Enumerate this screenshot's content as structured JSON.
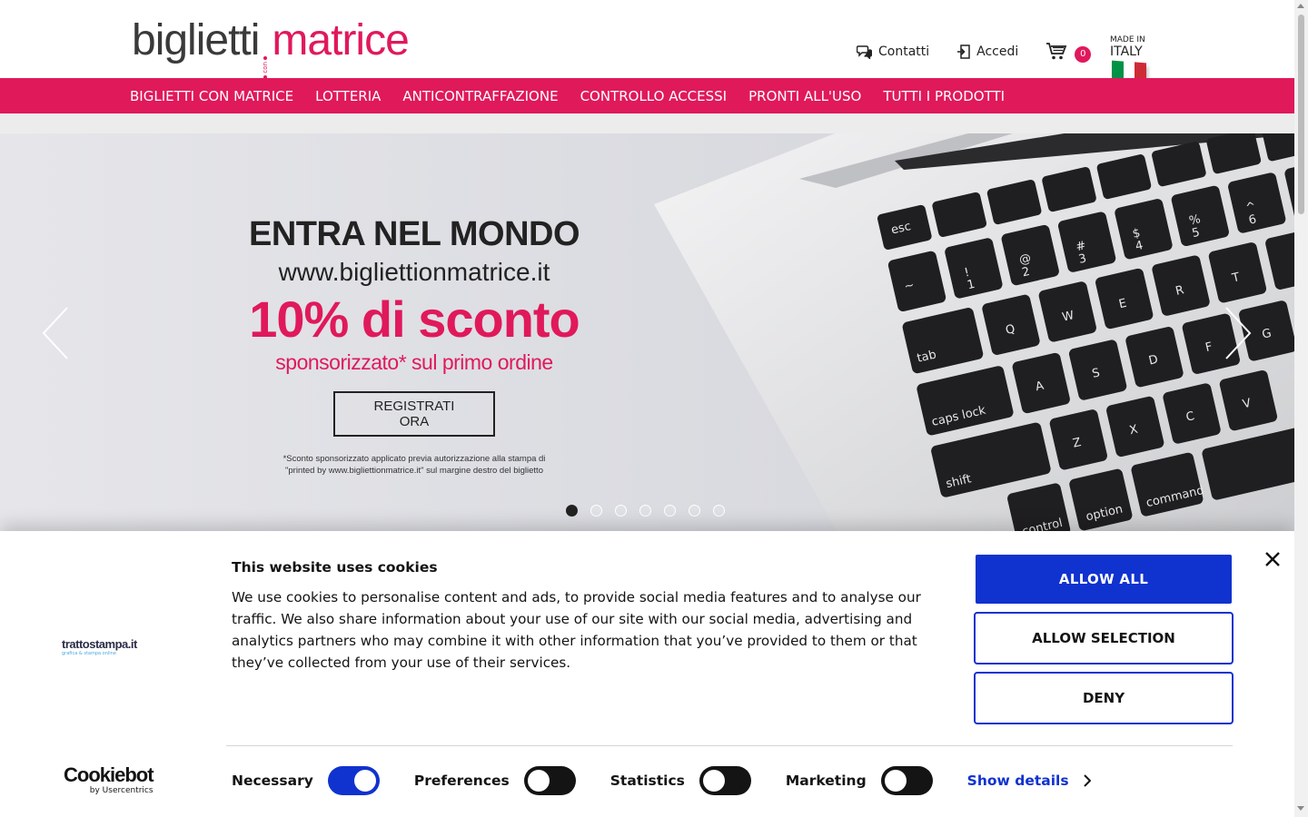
{
  "header": {
    "logo": {
      "part1": "biglietti",
      "connector": "con",
      "part2": "matrice"
    },
    "contacts_label": "Contatti",
    "login_label": "Accedi",
    "cart_count": "0",
    "made_in_line1": "MADE IN",
    "made_in_line2": "ITALY",
    "flag_colors": [
      "#009246",
      "#ffffff",
      "#ce2b37"
    ]
  },
  "nav": {
    "items": [
      {
        "label": "BIGLIETTI CON MATRICE"
      },
      {
        "label": "LOTTERIA"
      },
      {
        "label": "ANTICONTRAFFAZIONE"
      },
      {
        "label": "CONTROLLO ACCESSI"
      },
      {
        "label": "PRONTI ALL'USO"
      },
      {
        "label": "TUTTI I PRODOTTI"
      }
    ]
  },
  "hero": {
    "title": "ENTRA NEL MONDO",
    "url": "www.bigliettionmatrice.it",
    "discount": "10% di sconto",
    "subtitle": "sponsorizzato* sul primo ordine",
    "cta": "REGISTRATI ORA",
    "footnote_line1": "*Sconto sponsorizzato applicato previa autorizzazione alla stampa di",
    "footnote_line2": "\"printed by www.bigliettionmatrice.it\" sul margine destro del biglietto",
    "slide_count": 7,
    "active_slide": 1
  },
  "cookie": {
    "brand_name": "trattostampa.it",
    "brand_tagline": "grafica & stampa online",
    "title": "This website uses cookies",
    "body": "We use cookies to personalise content and ads, to provide social media features and to analyse our traffic. We also share information about your use of our site with our social media, advertising and analytics partners who may combine it with other information that you’ve provided to them or that they’ve collected from your use of their services.",
    "allow_all": "ALLOW ALL",
    "allow_selection": "ALLOW SELECTION",
    "deny": "DENY",
    "toggles": [
      {
        "label": "Necessary",
        "on": true
      },
      {
        "label": "Preferences",
        "on": false
      },
      {
        "label": "Statistics",
        "on": false
      },
      {
        "label": "Marketing",
        "on": false
      }
    ],
    "show_details": "Show details",
    "cookiebot_name": "Cookiebot",
    "cookiebot_by": "by Usercentrics"
  },
  "colors": {
    "brand": "#e0195b",
    "cookie_accent": "#1032cf"
  }
}
